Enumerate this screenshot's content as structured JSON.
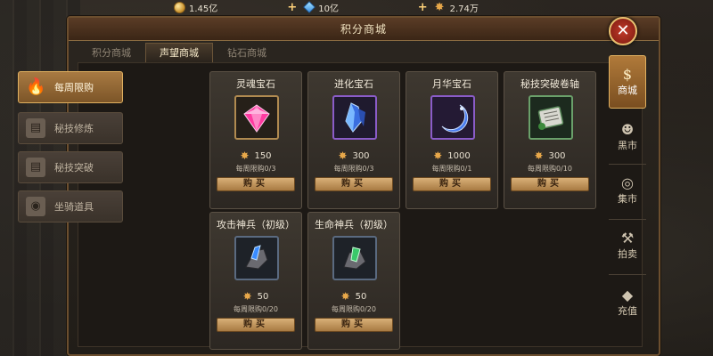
{
  "currency": {
    "coins": "1.45亿",
    "gems": "10亿",
    "points": "2.74万"
  },
  "panel": {
    "title": "积分商城",
    "tabs": [
      "积分商城",
      "声望商城",
      "钻石商城"
    ],
    "active_tab": 1
  },
  "left_nav": [
    {
      "label": "每周限购",
      "icon": "flame-icon",
      "active": true
    },
    {
      "label": "秘技修炼",
      "icon": "scroll-icon",
      "active": false
    },
    {
      "label": "秘技突破",
      "icon": "scroll-icon",
      "active": false
    },
    {
      "label": "坐骑道具",
      "icon": "mount-icon",
      "active": false
    }
  ],
  "items": [
    {
      "name": "灵魂宝石",
      "price": "150",
      "limit": "每周限购0/3",
      "buy": "购买",
      "icon": "pink-gem-icon"
    },
    {
      "name": "进化宝石",
      "price": "300",
      "limit": "每周限购0/3",
      "buy": "购买",
      "icon": "blue-crystal-icon"
    },
    {
      "name": "月华宝石",
      "price": "1000",
      "limit": "每周限购0/1",
      "buy": "购买",
      "icon": "moon-gem-icon"
    },
    {
      "name": "秘技突破卷轴",
      "price": "300",
      "limit": "每周限购0/10",
      "buy": "购买",
      "icon": "scroll-item-icon"
    },
    {
      "name": "攻击神兵（初级）",
      "price": "50",
      "limit": "每周限购0/20",
      "buy": "购买",
      "icon": "blue-weapon-icon"
    },
    {
      "name": "生命神兵（初级）",
      "price": "50",
      "limit": "每周限购0/20",
      "buy": "购买",
      "icon": "green-weapon-icon"
    }
  ],
  "side_tabs": [
    {
      "label": "商城",
      "icon": "money-bag-icon",
      "active": true
    },
    {
      "label": "黑市",
      "icon": "merchant-icon",
      "active": false
    },
    {
      "label": "集市",
      "icon": "coins-stack-icon",
      "active": false
    },
    {
      "label": "拍卖",
      "icon": "gavel-icon",
      "active": false
    },
    {
      "label": "充值",
      "icon": "diamond-icon",
      "active": false
    }
  ],
  "colors": {
    "accent": "#a87a42",
    "panel_border": "#6b4e2e",
    "close": "#c23a2a"
  }
}
